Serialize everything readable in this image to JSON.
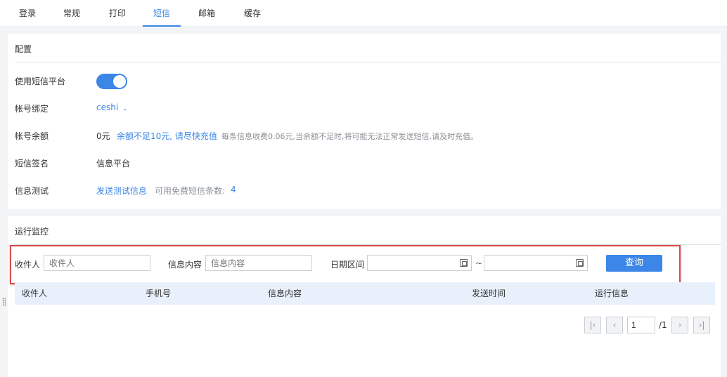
{
  "tabs": [
    "登录",
    "常规",
    "打印",
    "短信",
    "邮箱",
    "缓存"
  ],
  "active_tab": "短信",
  "config": {
    "title": "配置",
    "use_platform_label": "使用短信平台",
    "use_platform_enabled": true,
    "account_bind_label": "帐号绑定",
    "account_bind_value": "ceshi",
    "balance_label": "帐号余额",
    "balance_value": "0元",
    "balance_warning": "余额不足10元, 请尽快充值",
    "balance_note": "每条信息收费0.06元,当余额不足时,将可能无法正常发送短信,请及时充值。",
    "signature_label": "短信签名",
    "signature_value": "信息平台",
    "test_label": "信息测试",
    "test_link": "发送测试信息",
    "free_count_label": "可用免费短信条数:",
    "free_count_value": "4"
  },
  "monitor": {
    "title": "运行监控",
    "recipient_label": "收件人",
    "recipient_placeholder": "收件人",
    "content_label": "信息内容",
    "content_placeholder": "信息内容",
    "date_label": "日期区间",
    "date_sep": "~",
    "query_button": "查询",
    "columns": [
      "收件人",
      "手机号",
      "信息内容",
      "发送时间",
      "运行信息"
    ],
    "rows": []
  },
  "pagination": {
    "current_page": "1",
    "total_label": "/1"
  },
  "colors": {
    "accent": "#3b86e6",
    "highlight_border": "#d94b4b",
    "table_header_bg": "#e8f0fb"
  }
}
